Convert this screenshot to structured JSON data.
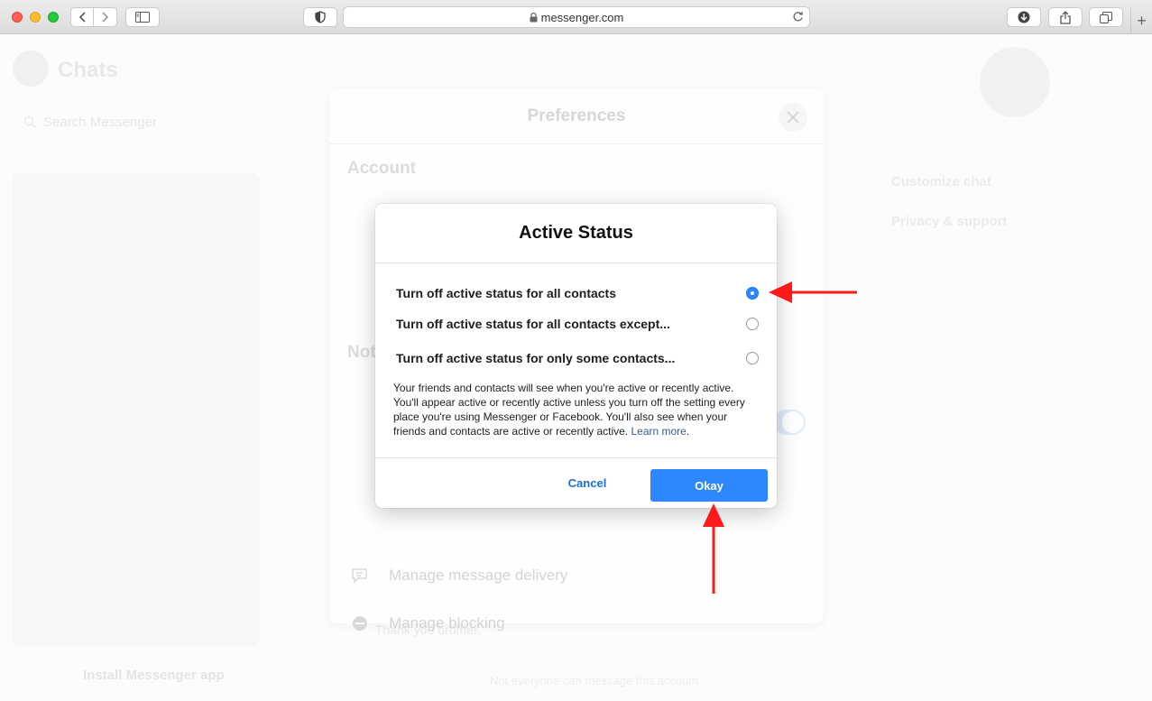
{
  "browser": {
    "url": "messenger.com"
  },
  "background": {
    "chats_title": "Chats",
    "search_placeholder": "Search Messenger",
    "install_label": "Install Messenger app",
    "customize_chat": "Customize chat",
    "privacy_support": "Privacy & support",
    "thanks_message": "Thank you brother.",
    "not_everyone": "Not everyone can message this account."
  },
  "preferences": {
    "title": "Preferences",
    "account_section": "Account",
    "notifications_section": "Not",
    "rows": [
      {
        "label": "Manage message delivery",
        "icon": "message-delivery-icon"
      },
      {
        "label": "Manage blocking",
        "icon": "blocking-icon"
      }
    ]
  },
  "dialog": {
    "title": "Active Status",
    "options": [
      {
        "label": "Turn off active status for all contacts",
        "checked": true
      },
      {
        "label": "Turn off active status for all contacts except...",
        "checked": false
      },
      {
        "label": "Turn off active status for only some contacts...",
        "checked": false
      }
    ],
    "description": "Your friends and contacts will see when you're active or recently active. You'll appear active or recently active unless you turn off the setting every place you're using Messenger or Facebook. You'll also see when your friends and contacts are active or recently active.",
    "learn_more": "Learn more",
    "cancel_label": "Cancel",
    "okay_label": "Okay"
  },
  "colors": {
    "accent": "#2d88ff",
    "link": "#385898",
    "annotation_arrow": "#ff1a1a"
  }
}
